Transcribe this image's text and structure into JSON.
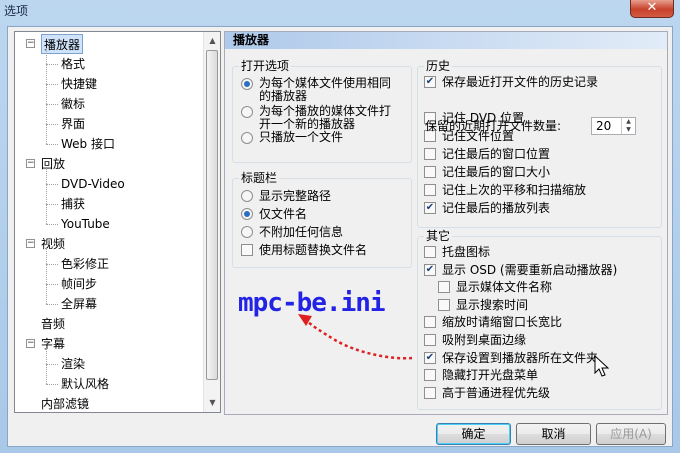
{
  "window": {
    "title": "选项",
    "close": "✕"
  },
  "tree": {
    "items": [
      {
        "label": "播放器",
        "level": 0,
        "box": "−",
        "selected": true
      },
      {
        "label": "格式",
        "level": 1
      },
      {
        "label": "快捷键",
        "level": 1
      },
      {
        "label": "徽标",
        "level": 1
      },
      {
        "label": "界面",
        "level": 1
      },
      {
        "label": "Web 接口",
        "level": 1
      },
      {
        "label": "回放",
        "level": 0,
        "box": "−"
      },
      {
        "label": "DVD-Video",
        "level": 1
      },
      {
        "label": "捕获",
        "level": 1
      },
      {
        "label": "YouTube",
        "level": 1
      },
      {
        "label": "视频",
        "level": 0,
        "box": "−"
      },
      {
        "label": "色彩修正",
        "level": 1
      },
      {
        "label": "帧间步",
        "level": 1
      },
      {
        "label": "全屏幕",
        "level": 1
      },
      {
        "label": "音频",
        "level": 0
      },
      {
        "label": "字幕",
        "level": 0,
        "box": "−"
      },
      {
        "label": "渲染",
        "level": 1
      },
      {
        "label": "默认风格",
        "level": 1
      },
      {
        "label": "内部滤镜",
        "level": 0
      }
    ]
  },
  "panel": {
    "title": "播放器",
    "open_group": {
      "title": "打开选项",
      "options": [
        {
          "label": "为每个媒体文件使用相同\n的播放器",
          "checked": true
        },
        {
          "label": "为每个播放的媒体文件打\n开一个新的播放器",
          "checked": false
        },
        {
          "label": "只播放一个文件",
          "checked": false
        }
      ]
    },
    "title_group": {
      "title": "标题栏",
      "options": [
        {
          "label": "显示完整路径",
          "checked": false
        },
        {
          "label": "仅文件名",
          "checked": true
        },
        {
          "label": "不附加任何信息",
          "checked": false
        }
      ],
      "checkbox": {
        "label": "使用标题替换文件名",
        "checked": false
      }
    },
    "history_group": {
      "title": "历史",
      "items": [
        {
          "label": "保存最近打开文件的历史记录",
          "checked": true
        },
        {
          "label": "记住 DVD 位置",
          "checked": false
        },
        {
          "label": "记住文件位置",
          "checked": false
        },
        {
          "label": "记住最后的窗口位置",
          "checked": false
        },
        {
          "label": "记住最后的窗口大小",
          "checked": false
        },
        {
          "label": "记住上次的平移和扫描缩放",
          "checked": false
        },
        {
          "label": "记住最后的播放列表",
          "checked": true
        }
      ],
      "recent_label": "保留的近期打开文件数量:",
      "recent_value": "20"
    },
    "other_group": {
      "title": "其它",
      "items": [
        {
          "label": "托盘图标",
          "checked": false,
          "indent": 0
        },
        {
          "label": "显示 OSD (需要重新启动播放器)",
          "checked": true,
          "indent": 0
        },
        {
          "label": "显示媒体文件名称",
          "checked": false,
          "indent": 1
        },
        {
          "label": "显示搜索时间",
          "checked": false,
          "indent": 1
        },
        {
          "label": "缩放时请缩窗口长宽比",
          "checked": false,
          "indent": 0
        },
        {
          "label": "吸附到桌面边缘",
          "checked": false,
          "indent": 0
        },
        {
          "label": "保存设置到播放器所在文件夹",
          "checked": true,
          "indent": 0
        },
        {
          "label": "隐藏打开光盘菜单",
          "checked": false,
          "indent": 0
        },
        {
          "label": "高于普通进程优先级",
          "checked": false,
          "indent": 0
        }
      ]
    }
  },
  "buttons": {
    "ok": "确定",
    "cancel": "取消",
    "apply": "应用(A)"
  },
  "annotation": {
    "text": "mpc-be.ini",
    "color": "#2323e6",
    "arrow_color": "#e02020"
  }
}
